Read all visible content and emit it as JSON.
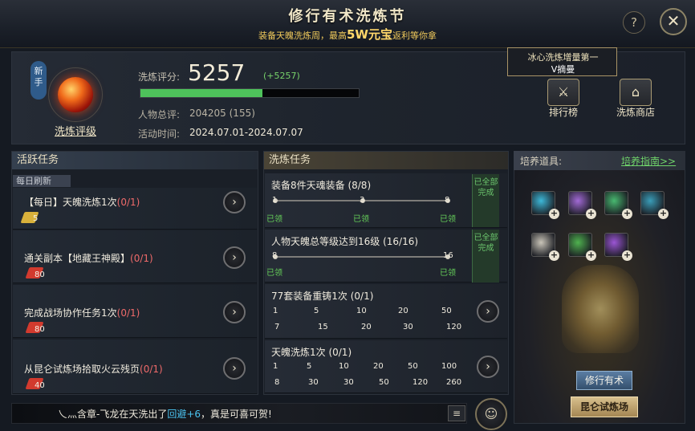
{
  "header": {
    "title": "修行有术洗炼节",
    "subtitle_pre": "装备天魄洗炼周，最高",
    "subtitle_big": "5W元宝",
    "subtitle_post": "返利等你拿",
    "help_label": "?",
    "close_label": "✕"
  },
  "profile": {
    "badge": "新手",
    "rank_link": "洗炼评级",
    "score_label": "洗炼评分:",
    "score_value": "5257",
    "score_delta": "(+5257)",
    "score_progress": 0.56,
    "person_label": "人物总评:",
    "person_value": "204205 (155)",
    "time_label": "活动时间:",
    "time_value": "2024.07.01-2024.07.07"
  },
  "leaderboard_top": {
    "title": "冰心洗炼增量第一",
    "name": "V摘曼"
  },
  "buttons": {
    "ranking": "排行榜",
    "shop": "洗炼商店",
    "practice": "修行有术",
    "trial": "昆仑试炼场"
  },
  "active_tasks": {
    "header": "活跃任务",
    "refresh_label": "每日刷新",
    "items": [
      {
        "name": "【每日】天魄洗炼1次",
        "progress": "(0/1)",
        "reward": "5",
        "reward_color": "#d9b13b"
      },
      {
        "name": "通关副本【地藏王神殿】",
        "progress": "(0/1)",
        "reward": "80",
        "reward_color": "#d23a2e"
      },
      {
        "name": "完成战场协作任务1次",
        "progress": "(0/1)",
        "reward": "80",
        "reward_color": "#d23a2e"
      },
      {
        "name": "从昆仑试炼场拾取火云残页",
        "progress": "(0/1)",
        "reward": "40",
        "reward_color": "#d23a2e"
      }
    ]
  },
  "wash_tasks": {
    "header": "洗炼任务",
    "done_label": "已全部完成",
    "got_label": "已领",
    "items": [
      {
        "name": "装备8件天魂装备 (8/8)",
        "milestones": [
          "1",
          "3",
          "8"
        ],
        "status": "done"
      },
      {
        "name": "人物天魄总等级达到16级 (16/16)",
        "milestones": [
          "8",
          "16"
        ],
        "status": "done"
      },
      {
        "name": "77套装备重铸1次 (0/1)",
        "milestones": [
          "1",
          "5",
          "10",
          "20",
          "50"
        ],
        "rewards": [
          "7",
          "15",
          "20",
          "30",
          "120"
        ],
        "status": "open"
      },
      {
        "name": "天魄洗炼1次 (0/1)",
        "milestones": [
          "1",
          "5",
          "10",
          "20",
          "50",
          "100"
        ],
        "rewards": [
          "8",
          "30",
          "30",
          "50",
          "120",
          "260"
        ],
        "status": "open"
      }
    ]
  },
  "cultivation": {
    "label": "培养道具:",
    "guide_link": "培养指南>>",
    "items": [
      {
        "color": "#3db8d8"
      },
      {
        "color": "#a26ad6"
      },
      {
        "color": "#48b870"
      },
      {
        "color": "#3a9db8"
      },
      {
        "color": "#c9c4b8"
      },
      {
        "color": "#4fb24f"
      },
      {
        "color": "#9b55d4"
      }
    ]
  },
  "broadcast": {
    "text_pre": "乀灬含章-飞龙在天洗出了",
    "text_hl": "回避+6",
    "text_post": "，真是可喜可贺!"
  },
  "icons": {
    "go": "›",
    "plus": "+",
    "list": "≡",
    "face": "☺",
    "ranking": "⚔",
    "shop": "⌂"
  }
}
